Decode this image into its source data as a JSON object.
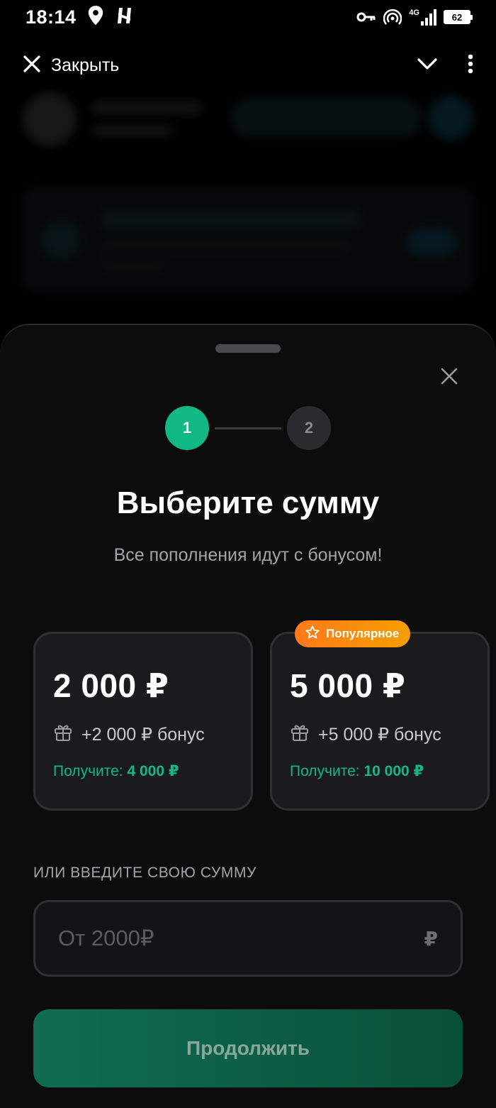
{
  "status_bar": {
    "time": "18:14",
    "network": "4G",
    "battery": "62"
  },
  "top_bar": {
    "close_label": "Закрыть"
  },
  "sheet": {
    "steps": [
      "1",
      "2"
    ],
    "active_step": 1,
    "title": "Выберите сумму",
    "subtitle": "Все пополнения идут с бонусом!",
    "cards": [
      {
        "amount": "2 000 ₽",
        "bonus": "+2 000 ₽ бонус",
        "total_label": "Получите:",
        "total_value": "4 000 ₽"
      },
      {
        "amount": "5 000 ₽",
        "bonus": "+5 000 ₽ бонус",
        "total_label": "Получите:",
        "total_value": "10 000 ₽",
        "badge": "Популярное"
      }
    ],
    "custom_amount_label": "ИЛИ ВВЕДИТЕ СВОЮ СУММУ",
    "custom_amount_placeholder": "От 2000₽",
    "currency_symbol": "₽",
    "continue_label": "Продолжить"
  },
  "colors": {
    "accent_green": "#12b886",
    "badge_orange": "#ff7a1a",
    "sheet_bg": "#0c0c0d",
    "card_bg": "#1b1b1e"
  },
  "icons": [
    "location-icon",
    "notification-app-icon",
    "vpn-key-icon",
    "hotspot-icon",
    "signal-icon",
    "battery-icon",
    "close-icon",
    "chevron-down-icon",
    "more-vertical-icon",
    "gift-icon",
    "star-icon"
  ]
}
